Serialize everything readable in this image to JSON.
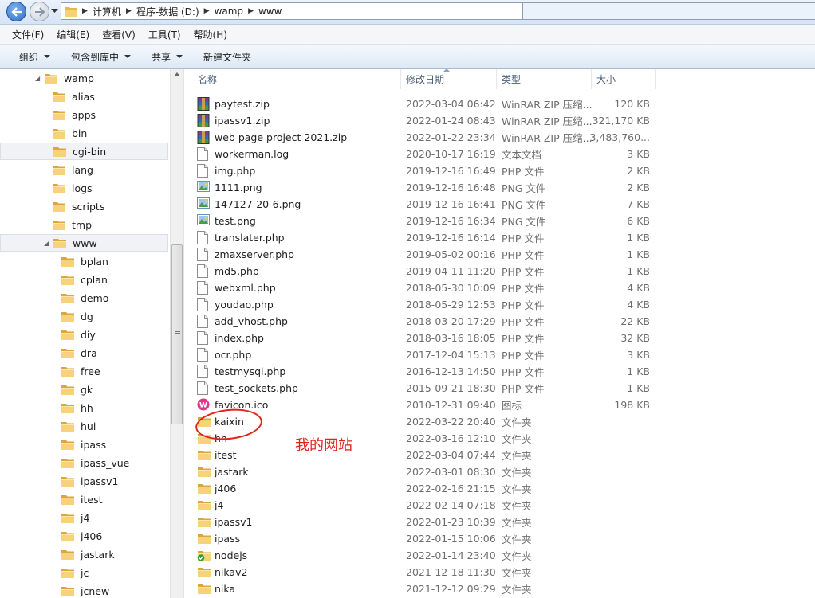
{
  "address": {
    "crumbs": [
      "计算机",
      "程序-数据 (D:)",
      "wamp",
      "www"
    ]
  },
  "menu": [
    "文件(F)",
    "编辑(E)",
    "查看(V)",
    "工具(T)",
    "帮助(H)"
  ],
  "toolbar": [
    {
      "label": "组织",
      "dropdown": true
    },
    {
      "label": "包含到库中",
      "dropdown": true
    },
    {
      "label": "共享",
      "dropdown": true
    },
    {
      "label": "新建文件夹",
      "dropdown": false
    }
  ],
  "nav_tree": [
    {
      "label": "wamp",
      "level": 0,
      "expanded": true
    },
    {
      "label": "alias",
      "level": 1
    },
    {
      "label": "apps",
      "level": 1
    },
    {
      "label": "bin",
      "level": 1
    },
    {
      "label": "cgi-bin",
      "level": 1,
      "selected": true
    },
    {
      "label": "lang",
      "level": 1
    },
    {
      "label": "logs",
      "level": 1
    },
    {
      "label": "scripts",
      "level": 1
    },
    {
      "label": "tmp",
      "level": 1
    },
    {
      "label": "www",
      "level": 1,
      "expanded": true,
      "selected": true
    },
    {
      "label": "bplan",
      "level": 2
    },
    {
      "label": "cplan",
      "level": 2
    },
    {
      "label": "demo",
      "level": 2
    },
    {
      "label": "dg",
      "level": 2
    },
    {
      "label": "diy",
      "level": 2
    },
    {
      "label": "dra",
      "level": 2
    },
    {
      "label": "free",
      "level": 2
    },
    {
      "label": "gk",
      "level": 2
    },
    {
      "label": "hh",
      "level": 2
    },
    {
      "label": "hui",
      "level": 2
    },
    {
      "label": "ipass",
      "level": 2
    },
    {
      "label": "ipass_vue",
      "level": 2
    },
    {
      "label": "ipassv1",
      "level": 2
    },
    {
      "label": "itest",
      "level": 2
    },
    {
      "label": "j4",
      "level": 2
    },
    {
      "label": "j406",
      "level": 2
    },
    {
      "label": "jastark",
      "level": 2
    },
    {
      "label": "jc",
      "level": 2
    },
    {
      "label": "jcnew",
      "level": 2
    }
  ],
  "columns": {
    "name": "名称",
    "date": "修改日期",
    "type": "类型",
    "size": "大小"
  },
  "files": [
    {
      "name": "paytest.zip",
      "date": "2022-03-04 06:42",
      "type": "WinRAR ZIP 压缩...",
      "size": "120 KB",
      "icon": "winrar-zip-icon"
    },
    {
      "name": "ipassv1.zip",
      "date": "2022-01-24 08:43",
      "type": "WinRAR ZIP 压缩...",
      "size": "321,170 KB",
      "icon": "winrar-zip-icon"
    },
    {
      "name": "web page project 2021.zip",
      "date": "2022-01-22 23:34",
      "type": "WinRAR ZIP 压缩...",
      "size": "3,483,760...",
      "icon": "winrar-zip-icon"
    },
    {
      "name": "workerman.log",
      "date": "2020-10-17 16:19",
      "type": "文本文档",
      "size": "3 KB",
      "icon": "document-icon"
    },
    {
      "name": "img.php",
      "date": "2019-12-16 16:49",
      "type": "PHP 文件",
      "size": "2 KB",
      "icon": "document-icon"
    },
    {
      "name": "1111.png",
      "date": "2019-12-16 16:48",
      "type": "PNG 文件",
      "size": "2 KB",
      "icon": "image-icon"
    },
    {
      "name": "147127-20-6.png",
      "date": "2019-12-16 16:41",
      "type": "PNG 文件",
      "size": "7 KB",
      "icon": "image-icon"
    },
    {
      "name": "test.png",
      "date": "2019-12-16 16:34",
      "type": "PNG 文件",
      "size": "6 KB",
      "icon": "image-icon"
    },
    {
      "name": "translater.php",
      "date": "2019-12-16 16:14",
      "type": "PHP 文件",
      "size": "1 KB",
      "icon": "document-icon"
    },
    {
      "name": "zmaxserver.php",
      "date": "2019-05-02 00:16",
      "type": "PHP 文件",
      "size": "1 KB",
      "icon": "document-icon"
    },
    {
      "name": "md5.php",
      "date": "2019-04-11 11:20",
      "type": "PHP 文件",
      "size": "1 KB",
      "icon": "document-icon"
    },
    {
      "name": "webxml.php",
      "date": "2018-05-30 10:09",
      "type": "PHP 文件",
      "size": "4 KB",
      "icon": "document-icon"
    },
    {
      "name": "youdao.php",
      "date": "2018-05-29 12:53",
      "type": "PHP 文件",
      "size": "4 KB",
      "icon": "document-icon"
    },
    {
      "name": "add_vhost.php",
      "date": "2018-03-20 17:29",
      "type": "PHP 文件",
      "size": "22 KB",
      "icon": "document-icon"
    },
    {
      "name": "index.php",
      "date": "2018-03-16 18:05",
      "type": "PHP 文件",
      "size": "32 KB",
      "icon": "document-icon"
    },
    {
      "name": "ocr.php",
      "date": "2017-12-04 15:13",
      "type": "PHP 文件",
      "size": "3 KB",
      "icon": "document-icon"
    },
    {
      "name": "testmysql.php",
      "date": "2016-12-13 14:50",
      "type": "PHP 文件",
      "size": "1 KB",
      "icon": "document-icon"
    },
    {
      "name": "test_sockets.php",
      "date": "2015-09-21 18:30",
      "type": "PHP 文件",
      "size": "1 KB",
      "icon": "document-icon"
    },
    {
      "name": "favicon.ico",
      "date": "2010-12-31 09:40",
      "type": "图标",
      "size": "198 KB",
      "icon": "wamp-favicon-icon"
    },
    {
      "name": "kaixin",
      "date": "2022-03-22 20:40",
      "type": "文件夹",
      "size": "",
      "icon": "folder-icon"
    },
    {
      "name": "hh",
      "date": "2022-03-16 12:10",
      "type": "文件夹",
      "size": "",
      "icon": "folder-icon"
    },
    {
      "name": "itest",
      "date": "2022-03-04 07:44",
      "type": "文件夹",
      "size": "",
      "icon": "folder-icon"
    },
    {
      "name": "jastark",
      "date": "2022-03-01 08:30",
      "type": "文件夹",
      "size": "",
      "icon": "folder-icon"
    },
    {
      "name": "j406",
      "date": "2022-02-16 21:15",
      "type": "文件夹",
      "size": "",
      "icon": "folder-icon"
    },
    {
      "name": "j4",
      "date": "2022-02-14 07:18",
      "type": "文件夹",
      "size": "",
      "icon": "folder-icon"
    },
    {
      "name": "ipassv1",
      "date": "2022-01-23 10:39",
      "type": "文件夹",
      "size": "",
      "icon": "folder-icon"
    },
    {
      "name": "ipass",
      "date": "2022-01-15 10:06",
      "type": "文件夹",
      "size": "",
      "icon": "folder-icon"
    },
    {
      "name": "nodejs",
      "date": "2022-01-14 23:40",
      "type": "文件夹",
      "size": "",
      "icon": "folder-check-icon"
    },
    {
      "name": "nikav2",
      "date": "2021-12-18 11:30",
      "type": "文件夹",
      "size": "",
      "icon": "folder-icon"
    },
    {
      "name": "nika",
      "date": "2021-12-12 09:29",
      "type": "文件夹",
      "size": "",
      "icon": "folder-icon"
    }
  ],
  "annotation": {
    "text": "我的网站",
    "color": "#e0231b"
  }
}
